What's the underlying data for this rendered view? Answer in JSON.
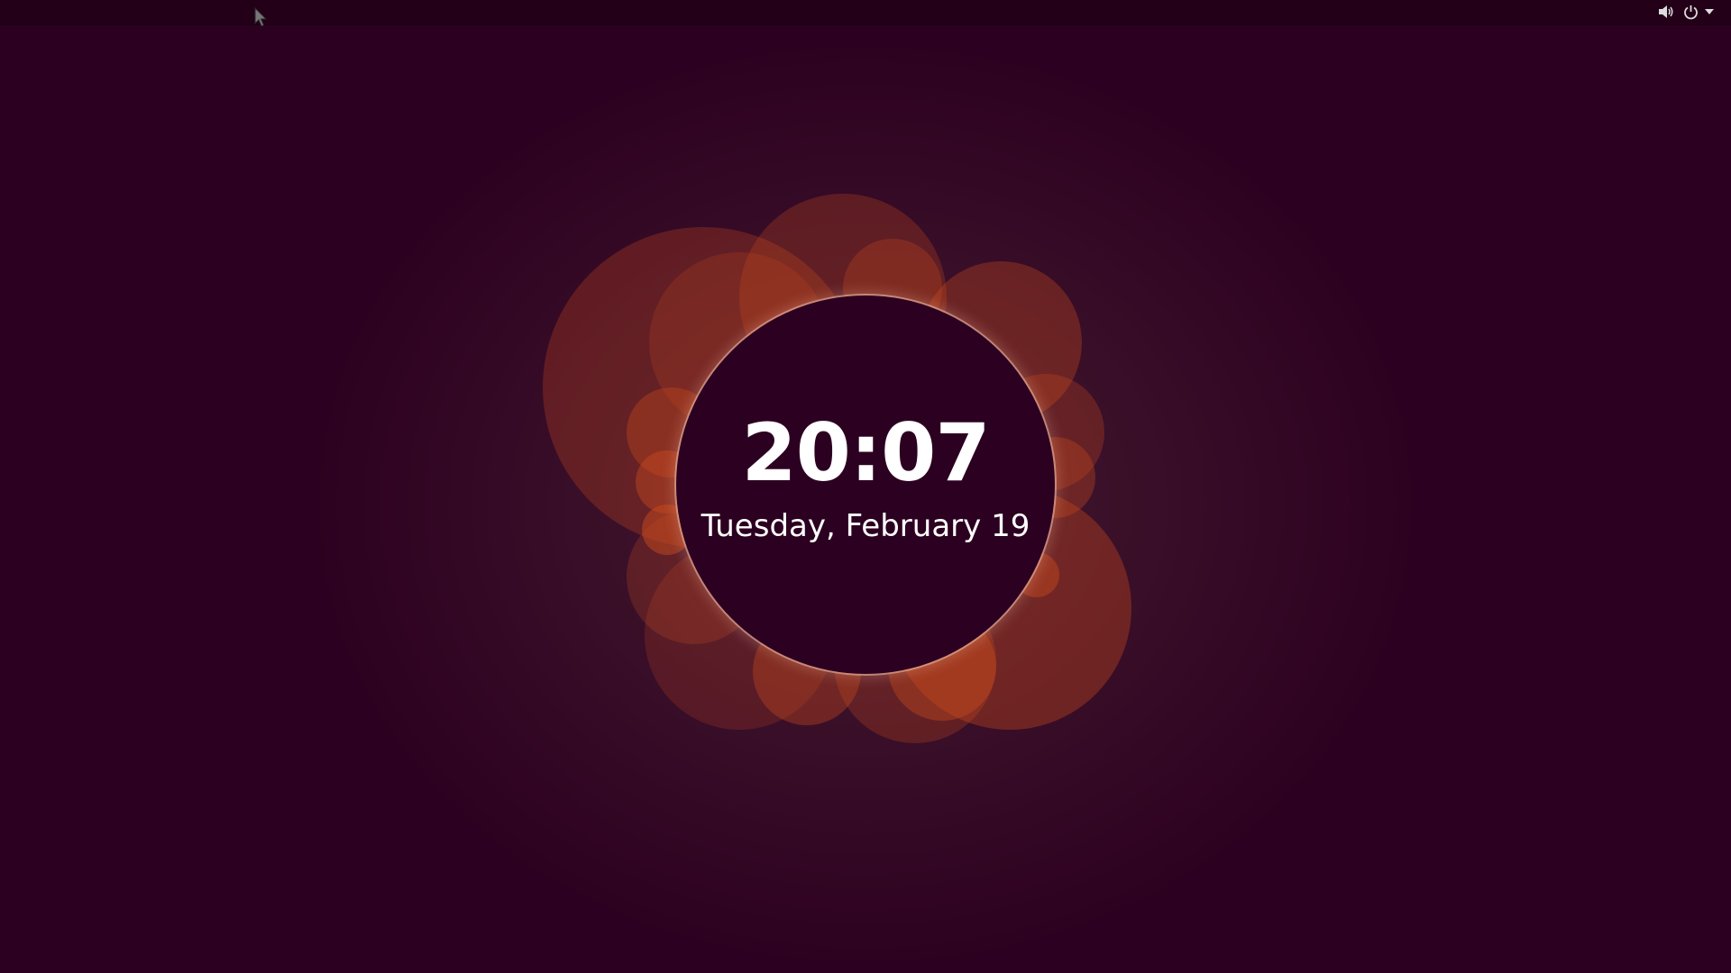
{
  "lock_screen": {
    "time": "20:07",
    "date": "Tuesday, February 19"
  },
  "top_bar": {
    "icons": [
      "volume-icon",
      "power-icon",
      "chevron-down-icon"
    ]
  },
  "colors": {
    "background": "#2c0020",
    "top_bar": "#230018",
    "bubble": "#c84a1e",
    "text": "#ffffff"
  }
}
